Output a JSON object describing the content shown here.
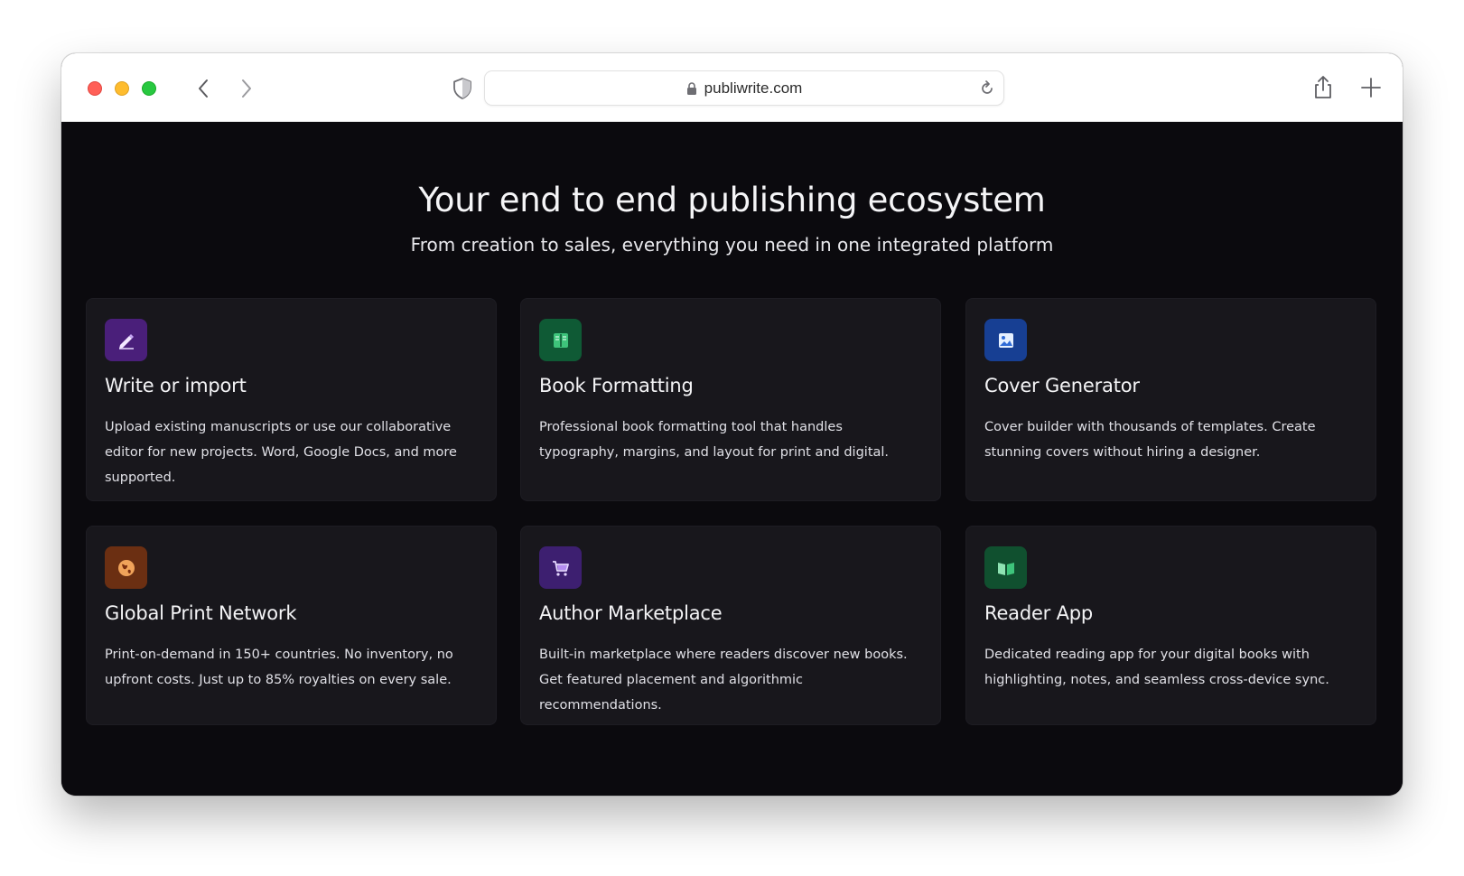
{
  "browser": {
    "url": "publiwrite.com"
  },
  "hero": {
    "title": "Your end to end publishing ecosystem",
    "subtitle": "From creation to sales, everything you need in one integrated platform"
  },
  "features": [
    {
      "title": "Write or import",
      "description": "Upload existing manuscripts or use our collaborative editor for new projects. Word, Google Docs, and more supported.",
      "icon": "pen-icon",
      "icon_bg": "#4a1f7a"
    },
    {
      "title": "Book Formatting",
      "description": "Professional book formatting tool that handles typography, margins, and layout for print and digital.",
      "icon": "book-icon",
      "icon_bg": "#0f5a35"
    },
    {
      "title": "Cover Generator",
      "description": "Cover builder with thousands of templates. Create stunning covers without hiring a designer.",
      "icon": "image-icon",
      "icon_bg": "#173f93"
    },
    {
      "title": "Global Print Network",
      "description": "Print-on-demand in 150+ countries. No inventory, no upfront costs. Just up to 85% royalties on every sale.",
      "icon": "globe-icon",
      "icon_bg": "#6b2f12"
    },
    {
      "title": "Author Marketplace",
      "description": "Built-in marketplace where readers discover new books. Get featured placement and algorithmic recommendations.",
      "icon": "cart-icon",
      "icon_bg": "#3d1f70"
    },
    {
      "title": "Reader App",
      "description": "Dedicated reading app for your digital books with highlighting, notes, and seamless cross-device sync.",
      "icon": "open-book-icon",
      "icon_bg": "#10502f"
    }
  ]
}
